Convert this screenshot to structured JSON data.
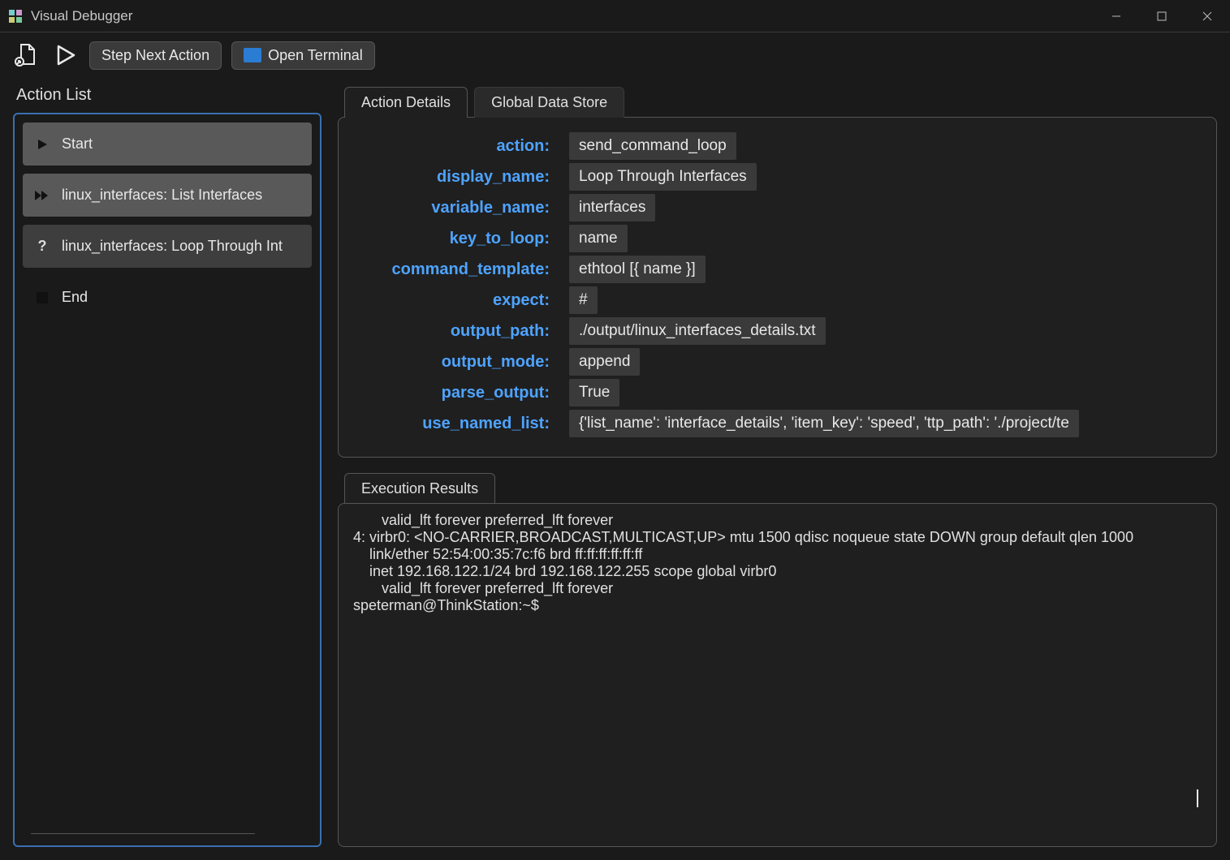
{
  "window": {
    "title": "Visual Debugger"
  },
  "toolbar": {
    "step_label": "Step Next Action",
    "terminal_label": "Open Terminal"
  },
  "action_list": {
    "title": "Action List",
    "items": [
      {
        "glyph": "play",
        "label": "Start"
      },
      {
        "glyph": "ff",
        "label": "linux_interfaces: List Interfaces"
      },
      {
        "glyph": "qmark",
        "label": "linux_interfaces: Loop Through Int"
      },
      {
        "glyph": "stop",
        "label": "End"
      }
    ]
  },
  "tabs": {
    "details": "Action Details",
    "global": "Global Data Store",
    "exec": "Execution Results"
  },
  "details": [
    {
      "key": "action:",
      "value": "send_command_loop"
    },
    {
      "key": "display_name:",
      "value": "Loop Through Interfaces"
    },
    {
      "key": "variable_name:",
      "value": "interfaces"
    },
    {
      "key": "key_to_loop:",
      "value": "name"
    },
    {
      "key": "command_template:",
      "value": "ethtool [{ name }]"
    },
    {
      "key": "expect:",
      "value": "#"
    },
    {
      "key": "output_path:",
      "value": "./output/linux_interfaces_details.txt"
    },
    {
      "key": "output_mode:",
      "value": "append"
    },
    {
      "key": "parse_output:",
      "value": "True"
    },
    {
      "key": "use_named_list:",
      "value": "{'list_name': 'interface_details', 'item_key': 'speed', 'ttp_path': './project/te"
    }
  ],
  "exec_output": "       valid_lft forever preferred_lft forever\n4: virbr0: <NO-CARRIER,BROADCAST,MULTICAST,UP> mtu 1500 qdisc noqueue state DOWN group default qlen 1000\n    link/ether 52:54:00:35:7c:f6 brd ff:ff:ff:ff:ff:ff\n    inet 192.168.122.1/24 brd 192.168.122.255 scope global virbr0\n       valid_lft forever preferred_lft forever\nspeterman@ThinkStation:~$ "
}
